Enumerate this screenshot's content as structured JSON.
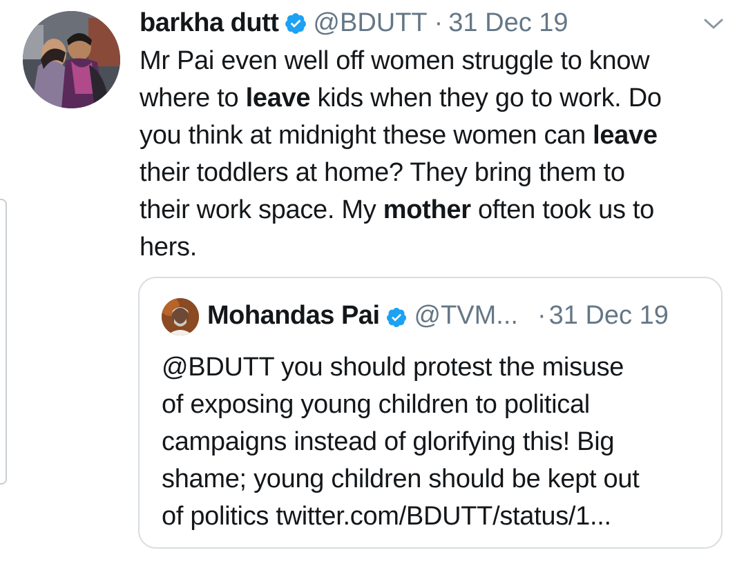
{
  "tweet": {
    "author": {
      "name": "barkha dutt",
      "handle": "@BDUTT",
      "verified": true
    },
    "separator": "·",
    "date": "31 Dec 19",
    "menu_icon": "chevron-down-icon",
    "text_lines": [
      [
        {
          "t": "Mr Pai even well off women struggle to know",
          "b": false
        }
      ],
      [
        {
          "t": "where to ",
          "b": false
        },
        {
          "t": "leave",
          "b": true
        },
        {
          "t": " kids when they go to work. Do",
          "b": false
        }
      ],
      [
        {
          "t": "you think at midnight these women can ",
          "b": false
        },
        {
          "t": "leave",
          "b": true
        }
      ],
      [
        {
          "t": "their toddlers at home? They bring them to",
          "b": false
        }
      ],
      [
        {
          "t": "their work space. My ",
          "b": false
        },
        {
          "t": "mother",
          "b": true
        },
        {
          "t": " often took us to",
          "b": false
        }
      ],
      [
        {
          "t": "hers.",
          "b": false
        }
      ]
    ]
  },
  "quoted_tweet": {
    "author": {
      "name": "Mohandas Pai",
      "handle": "@TVM...",
      "verified": true
    },
    "separator": "·",
    "date": "31 Dec 19",
    "text_lines": [
      "@BDUTT you should protest the misuse",
      "of exposing young children to political",
      "campaigns instead of glorifying this! Big",
      "shame; young children should be kept out",
      "of politics twitter.com/BDUTT/status/1..."
    ]
  },
  "colors": {
    "text": "#14171a",
    "secondary": "#657786",
    "verified_blue": "#1da1f2",
    "border": "#d7dde2"
  },
  "icons": [
    "verified-badge-icon",
    "chevron-down-icon"
  ]
}
